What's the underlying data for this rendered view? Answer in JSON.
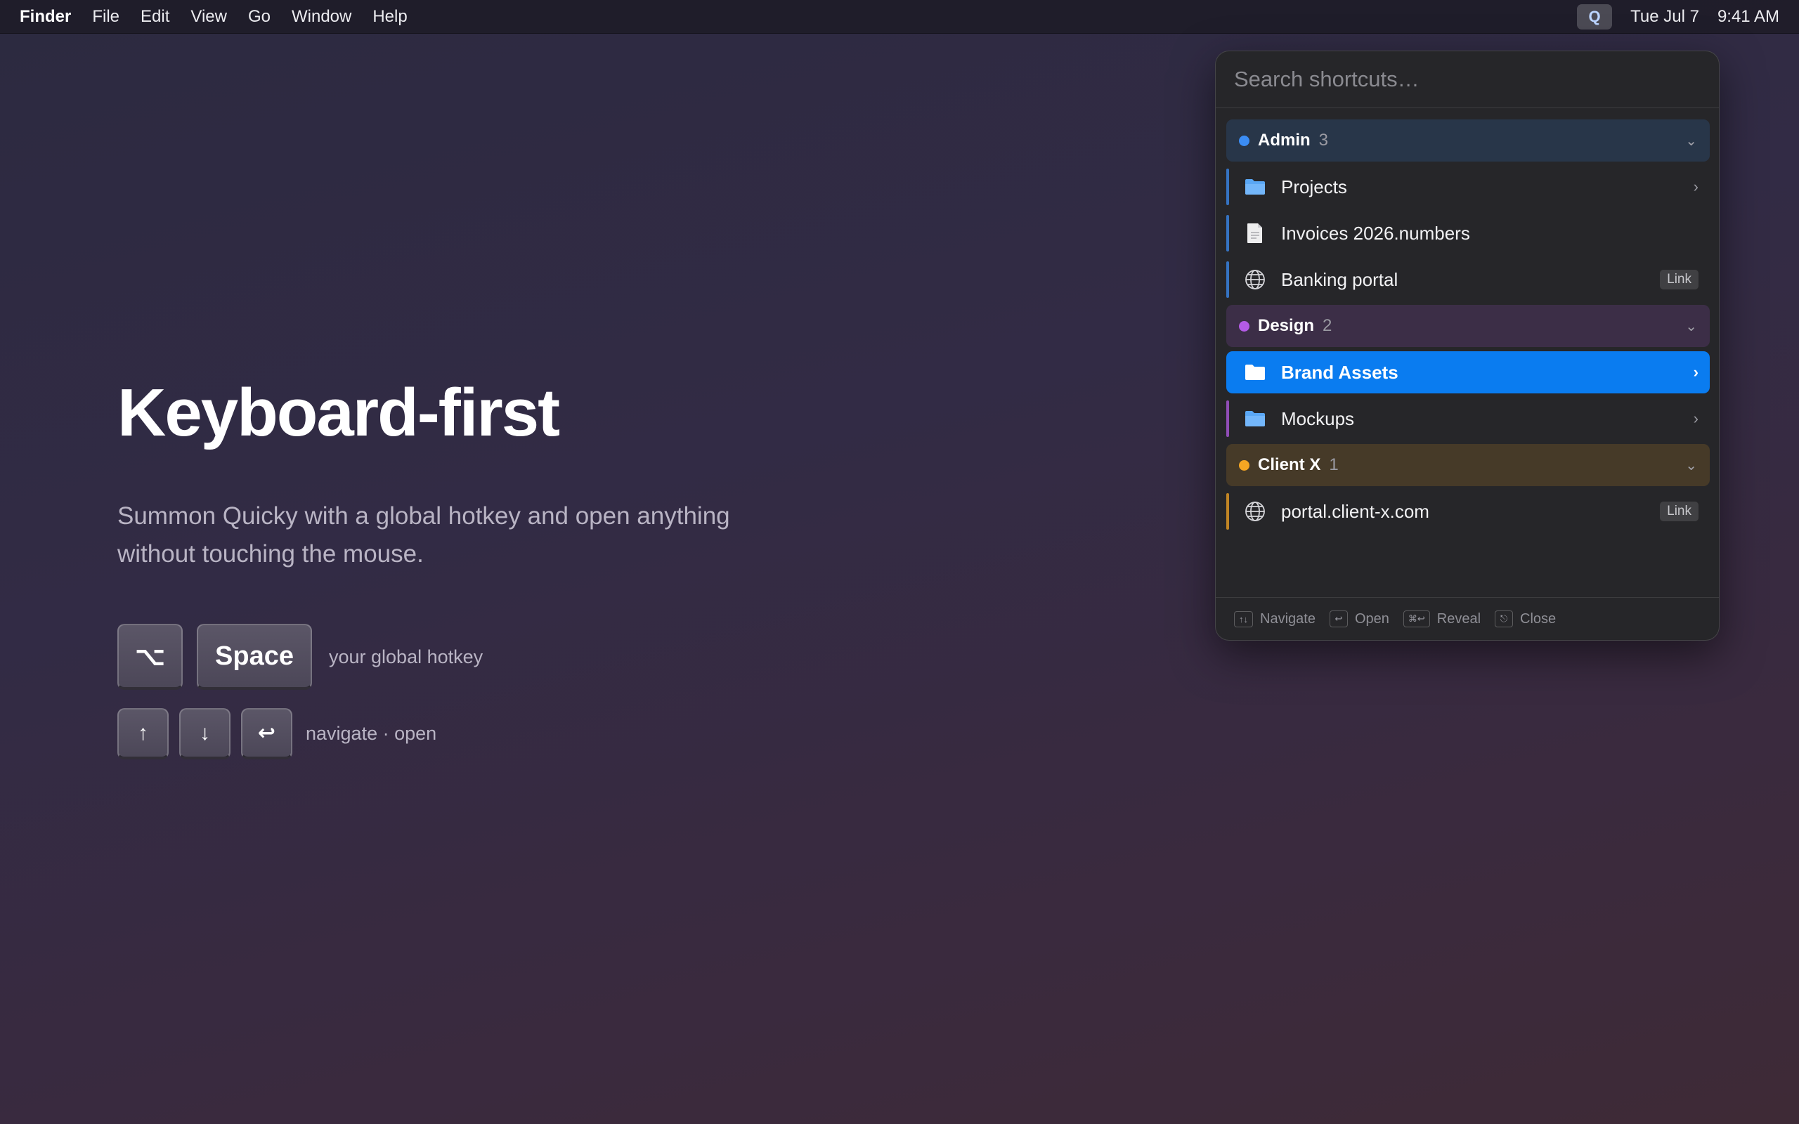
{
  "menubar": {
    "app_name": "Finder",
    "menus": [
      "File",
      "Edit",
      "View",
      "Go",
      "Window",
      "Help"
    ],
    "status_icon_label": "Q",
    "date": "Tue Jul 7",
    "time": "9:41 AM"
  },
  "hero": {
    "title": "Keyboard-first",
    "subtitle_line1": "Summon Quicky with a global hotkey and open anything",
    "subtitle_line2": "without touching the mouse.",
    "hotkey_keys": [
      "⌥",
      "Space"
    ],
    "hotkey_caption": "your global hotkey",
    "nav_keys": [
      "↑",
      "↓",
      "↩"
    ],
    "nav_caption": "navigate · open"
  },
  "panel": {
    "search_placeholder": "Search shortcuts…",
    "groups": [
      {
        "name": "Admin",
        "count": "3",
        "color": "#3b8df5",
        "items": [
          {
            "label": "Projects",
            "icon": "folder-icon",
            "chevron": true
          },
          {
            "label": "Invoices 2026.numbers",
            "icon": "document-icon"
          },
          {
            "label": "Banking portal",
            "icon": "globe-icon",
            "tag": "Link"
          }
        ]
      },
      {
        "name": "Design",
        "count": "2",
        "color": "#b45be6",
        "items": [
          {
            "label": "Brand Assets",
            "icon": "folder-icon",
            "chevron": true,
            "selected": true
          },
          {
            "label": "Mockups",
            "icon": "folder-icon",
            "chevron": true
          }
        ]
      },
      {
        "name": "Client X",
        "count": "1",
        "color": "#f5a623",
        "items": [
          {
            "label": "portal.client-x.com",
            "icon": "globe-icon",
            "tag": "Link"
          }
        ]
      }
    ],
    "footer_hints": [
      {
        "key": "↑↓",
        "label": "Navigate"
      },
      {
        "key": "↩",
        "label": "Open"
      },
      {
        "key": "⌘↩",
        "label": "Reveal"
      },
      {
        "key": "⎋",
        "label": "Close"
      }
    ]
  }
}
